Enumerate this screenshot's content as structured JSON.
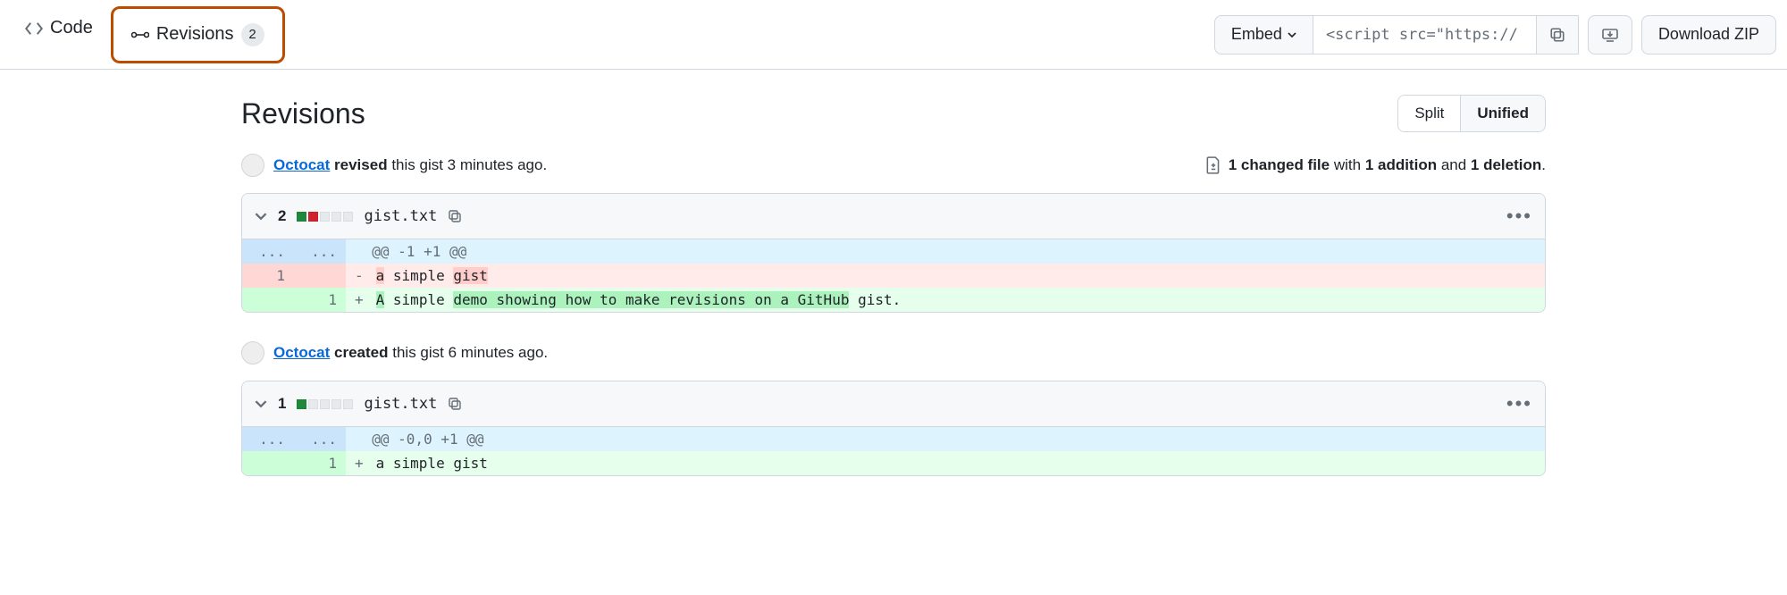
{
  "tabs": {
    "code": "Code",
    "revisions": "Revisions",
    "rev_count": "2"
  },
  "toolbar": {
    "embed": "Embed",
    "embed_url": "<script src=\"https://",
    "download_zip": "Download ZIP"
  },
  "page": {
    "title": "Revisions",
    "view_split": "Split",
    "view_unified": "Unified"
  },
  "revisions": [
    {
      "author": "Octocat",
      "action": "revised",
      "tail": "this gist 3 minutes ago.",
      "stats": {
        "files": "1 changed file",
        "with": " with ",
        "adds": "1 addition",
        "and": " and ",
        "dels": "1 deletion",
        "end": "."
      },
      "file": {
        "change_count": "2",
        "diffstat": [
          "add",
          "del",
          "neutral",
          "neutral",
          "neutral"
        ],
        "name": "gist.txt"
      },
      "hunk": "@@ -1 +1 @@",
      "lines": [
        {
          "type": "del",
          "old": "1",
          "new": "",
          "marker": "-",
          "segs": [
            {
              "t": "a",
              "hl": true
            },
            {
              "t": " simple ",
              "hl": false
            },
            {
              "t": "gist",
              "hl": true
            }
          ]
        },
        {
          "type": "add",
          "old": "",
          "new": "1",
          "marker": "+",
          "segs": [
            {
              "t": "A",
              "hl": true
            },
            {
              "t": " simple ",
              "hl": false
            },
            {
              "t": "demo showing how to make revisions on a GitHub",
              "hl": true
            },
            {
              "t": " gist.",
              "hl": false
            }
          ]
        }
      ]
    },
    {
      "author": "Octocat",
      "action": "created",
      "tail": "this gist 6 minutes ago.",
      "file": {
        "change_count": "1",
        "diffstat": [
          "add",
          "neutral",
          "neutral",
          "neutral",
          "neutral"
        ],
        "name": "gist.txt"
      },
      "hunk": "@@ -0,0 +1 @@",
      "lines": [
        {
          "type": "add",
          "old": "",
          "new": "1",
          "marker": "+",
          "segs": [
            {
              "t": "a simple gist",
              "hl": false
            }
          ]
        }
      ]
    }
  ]
}
